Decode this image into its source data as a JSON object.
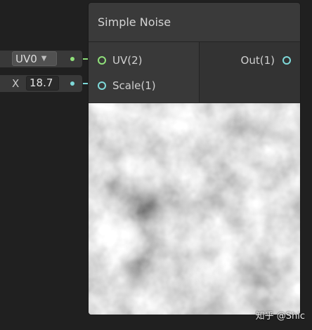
{
  "node": {
    "title": "Simple Noise",
    "inputs": [
      {
        "label": "UV(2)"
      },
      {
        "label": "Scale(1)"
      }
    ],
    "outputs": [
      {
        "label": "Out(1)"
      }
    ]
  },
  "uv_widget": {
    "value": "UV0",
    "caret": "▼"
  },
  "scale_widget": {
    "axis": "X",
    "value": "18.7"
  },
  "colors": {
    "uv_port": "#8fe07a",
    "scale_port": "#7ed9d9",
    "out_port": "#7ed9d9"
  },
  "watermark": "知乎 @Shic"
}
